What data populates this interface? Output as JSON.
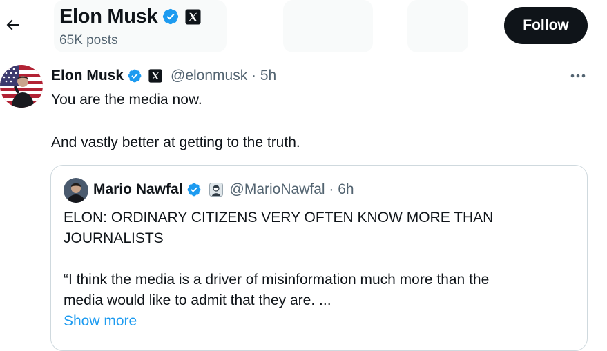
{
  "header": {
    "title": "Elon Musk",
    "posts_count": "65K posts",
    "follow_label": "Follow",
    "back_icon": "arrow-left-icon"
  },
  "tweet": {
    "author_name": "Elon Musk",
    "handle_time": "@elonmusk · 5h",
    "lines": [
      "You are the media now.",
      "And vastly better at getting to the truth."
    ],
    "more_icon": "more-horizontal-icon"
  },
  "quote": {
    "author_name": "Mario Nawfal",
    "handle_time": "@MarioNawfal · 6h",
    "lines": [
      "ELON: ORDINARY CITIZENS VERY OFTEN KNOW MORE THAN",
      "JOURNALISTS",
      "“I think the media is a driver of misinformation much more than the",
      "media would like to admit that they are. ..."
    ],
    "show_more": "Show more"
  },
  "colors": {
    "text_primary": "#0f1419",
    "text_secondary": "#536471",
    "verified_blue": "#1d9bf0",
    "link_blue": "#1d9bf0",
    "border": "#cfd9de",
    "follow_bg": "#0f1419"
  }
}
